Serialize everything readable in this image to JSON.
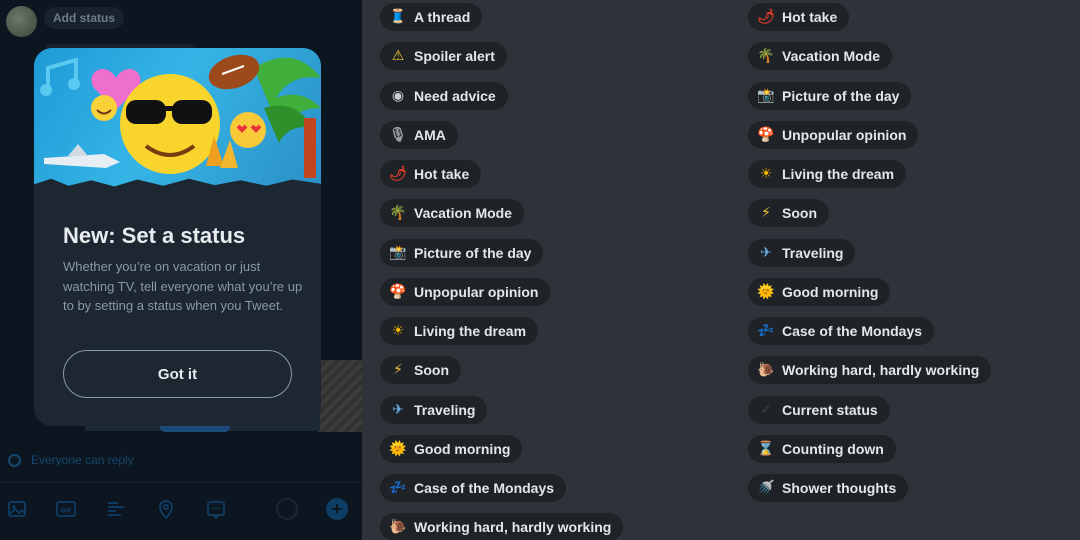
{
  "composer": {
    "add_status_label": "Add status",
    "reply_setting": "Everyone can reply"
  },
  "popup": {
    "title": "New: Set a status",
    "description": "Whether you’re on vacation or just watching TV, tell everyone what you’re up to by setting a status when you Tweet.",
    "button_label": "Got it"
  },
  "status_list_1": [
    {
      "label": "A thread",
      "icon": "spool-icon",
      "glyph": "🧵",
      "color": "#7b4fb0"
    },
    {
      "label": "Spoiler alert",
      "icon": "warning-icon",
      "glyph": "⚠",
      "color": "#f2c230"
    },
    {
      "label": "Need advice",
      "icon": "eye-icon",
      "glyph": "◉",
      "color": "#c9ccd0"
    },
    {
      "label": "AMA",
      "icon": "microphone-icon",
      "glyph": "🎙",
      "color": "#9aa0a6"
    },
    {
      "label": "Hot take",
      "icon": "chili-icon",
      "glyph": "🌶",
      "color": "#d63a2a"
    },
    {
      "label": "Vacation Mode",
      "icon": "palm-tree-icon",
      "glyph": "🌴",
      "color": "#3aa545"
    },
    {
      "label": "Picture of the day",
      "icon": "camera-flash-icon",
      "glyph": "📸",
      "color": "#8fb3d9"
    },
    {
      "label": "Unpopular opinion",
      "icon": "mushroom-icon",
      "glyph": "🍄",
      "color": "#e24a4a"
    },
    {
      "label": "Living the dream",
      "icon": "sun-icon",
      "glyph": "☀",
      "color": "#f5b400"
    },
    {
      "label": "Soon",
      "icon": "lightning-icon",
      "glyph": "⚡",
      "color": "#f6c23a"
    },
    {
      "label": "Traveling",
      "icon": "airplane-icon",
      "glyph": "✈",
      "color": "#6ab0e8"
    },
    {
      "label": "Good morning",
      "icon": "sun-face-icon",
      "glyph": "🌞",
      "color": "#f5b400"
    },
    {
      "label": "Case of the Mondays",
      "icon": "sleep-icon",
      "glyph": "💤",
      "color": "#5aa0e8"
    },
    {
      "label": "Working hard, hardly working",
      "icon": "snail-icon",
      "glyph": "🐌",
      "color": "#e0a040"
    }
  ],
  "status_list_2": [
    {
      "label": "Hot take",
      "icon": "chili-icon",
      "glyph": "🌶",
      "color": "#d63a2a"
    },
    {
      "label": "Vacation Mode",
      "icon": "palm-tree-icon",
      "glyph": "🌴",
      "color": "#3aa545"
    },
    {
      "label": "Picture of the day",
      "icon": "camera-flash-icon",
      "glyph": "📸",
      "color": "#8fb3d9"
    },
    {
      "label": "Unpopular opinion",
      "icon": "mushroom-icon",
      "glyph": "🍄",
      "color": "#e24a4a"
    },
    {
      "label": "Living the dream",
      "icon": "sun-icon",
      "glyph": "☀",
      "color": "#f5b400"
    },
    {
      "label": "Soon",
      "icon": "lightning-icon",
      "glyph": "⚡",
      "color": "#f6c23a"
    },
    {
      "label": "Traveling",
      "icon": "airplane-icon",
      "glyph": "✈",
      "color": "#6ab0e8"
    },
    {
      "label": "Good morning",
      "icon": "sun-face-icon",
      "glyph": "🌞",
      "color": "#f5b400"
    },
    {
      "label": "Case of the Mondays",
      "icon": "sleep-icon",
      "glyph": "💤",
      "color": "#5aa0e8"
    },
    {
      "label": "Working hard, hardly working",
      "icon": "snail-icon",
      "glyph": "🐌",
      "color": "#e0a040"
    },
    {
      "label": "Current status",
      "icon": "check-mark-icon",
      "glyph": "✓",
      "color": "#3a4048"
    },
    {
      "label": "Counting down",
      "icon": "hourglass-icon",
      "glyph": "⌛",
      "color": "#e8b04a"
    },
    {
      "label": "Shower thoughts",
      "icon": "shower-icon",
      "glyph": "🚿",
      "color": "#7aa8d8"
    }
  ]
}
